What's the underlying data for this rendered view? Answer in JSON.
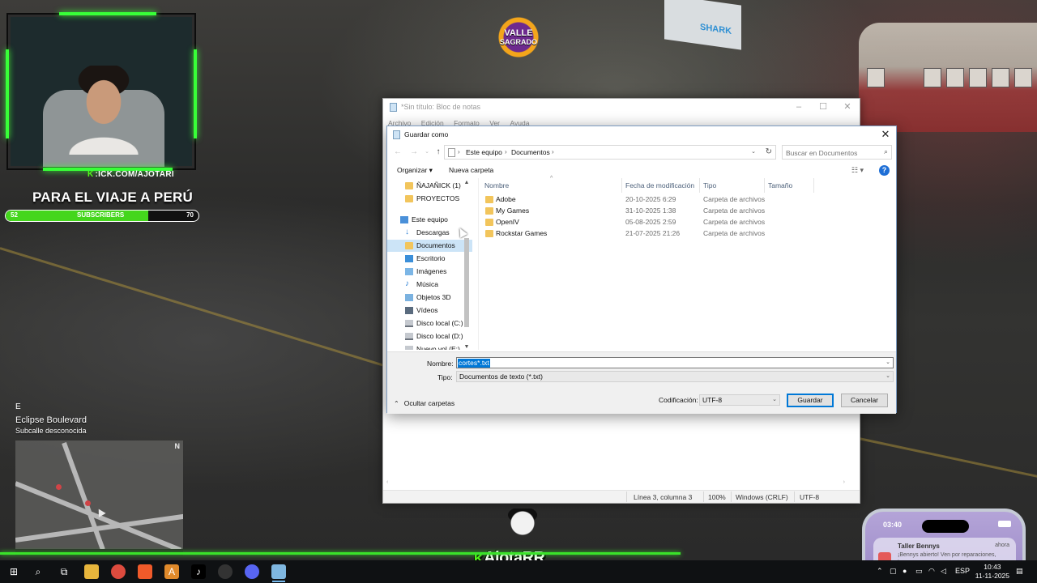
{
  "stream": {
    "link_prefix": "K",
    "link_text": ":ICK.COM/AJOTARI",
    "goal_title": "PARA EL VIAJE A PERÚ",
    "goal_label": "SUBSCRIBERS",
    "goal_current": "52",
    "goal_target": "70",
    "goal_progress": 0.74,
    "logo_line1": "VALLE",
    "logo_line2": "SAGRADO",
    "brand_prefix": "K",
    "brand_name": "AjotaRR",
    "billboard": "SHARK"
  },
  "hud": {
    "key_hint": "E",
    "street": "Eclipse Boulevard",
    "substreet": "Subcalle desconocida",
    "north": "N"
  },
  "phone": {
    "time": "03:40",
    "notif_title": "Taller Bennys",
    "notif_time": "ahora",
    "notif_body": "¡Bennys abierto! Ven por reparaciones, tuneos y"
  },
  "notepad": {
    "title": "*Sin título: Bloc de notas",
    "menu": [
      "Archivo",
      "Edición",
      "Formato",
      "Ver",
      "Ayuda"
    ],
    "status": {
      "position": "Línea 3, columna 3",
      "zoom": "100%",
      "eol": "Windows (CRLF)",
      "encoding": "UTF-8"
    }
  },
  "dialog": {
    "title": "Guardar como",
    "breadcrumb": [
      "Este equipo",
      "Documentos"
    ],
    "search_placeholder": "Buscar en Documentos",
    "organize_label": "Organizar ▾",
    "new_folder_label": "Nueva carpeta",
    "help": "?",
    "nav_items": [
      {
        "label": "ÑAJAÑICK (1)",
        "icon": "folder"
      },
      {
        "label": "PROYECTOS",
        "icon": "folder"
      },
      {
        "label": "Este equipo",
        "icon": "pc"
      },
      {
        "label": "Descargas",
        "icon": "download"
      },
      {
        "label": "Documentos",
        "icon": "documents"
      },
      {
        "label": "Escritorio",
        "icon": "desktop"
      },
      {
        "label": "Imágenes",
        "icon": "pictures"
      },
      {
        "label": "Música",
        "icon": "music"
      },
      {
        "label": "Objetos 3D",
        "icon": "3d-objects"
      },
      {
        "label": "Vídeos",
        "icon": "videos"
      },
      {
        "label": "Disco local (C:)",
        "icon": "drive"
      },
      {
        "label": "Disco local (D:)",
        "icon": "drive"
      },
      {
        "label": "Nuevo vol (E:)",
        "icon": "drive"
      }
    ],
    "columns": [
      "Nombre",
      "Fecha de modificación",
      "Tipo",
      "Tamaño"
    ],
    "files": [
      {
        "name": "Adobe",
        "date": "20-10-2025 6:29",
        "type": "Carpeta de archivos"
      },
      {
        "name": "My Games",
        "date": "31-10-2025 1:38",
        "type": "Carpeta de archivos"
      },
      {
        "name": "OpenIV",
        "date": "05-08-2025 2:59",
        "type": "Carpeta de archivos"
      },
      {
        "name": "Rockstar Games",
        "date": "21-07-2025 21:26",
        "type": "Carpeta de archivos"
      }
    ],
    "name_label": "Nombre:",
    "name_value": "cortes*.txt",
    "type_label": "Tipo:",
    "type_value": "Documentos de texto (*.txt)",
    "hide_folders": "Ocultar carpetas",
    "encoding_label": "Codificación:",
    "encoding_value": "UTF-8",
    "save_label": "Guardar",
    "cancel_label": "Cancelar"
  },
  "taskbar": {
    "lang": "ESP",
    "time": "10:43",
    "date": "11-11-2025"
  },
  "colors": {
    "kick_green": "#53fc18",
    "accent_blue": "#0078d7",
    "folder_yellow": "#f2c55c"
  }
}
